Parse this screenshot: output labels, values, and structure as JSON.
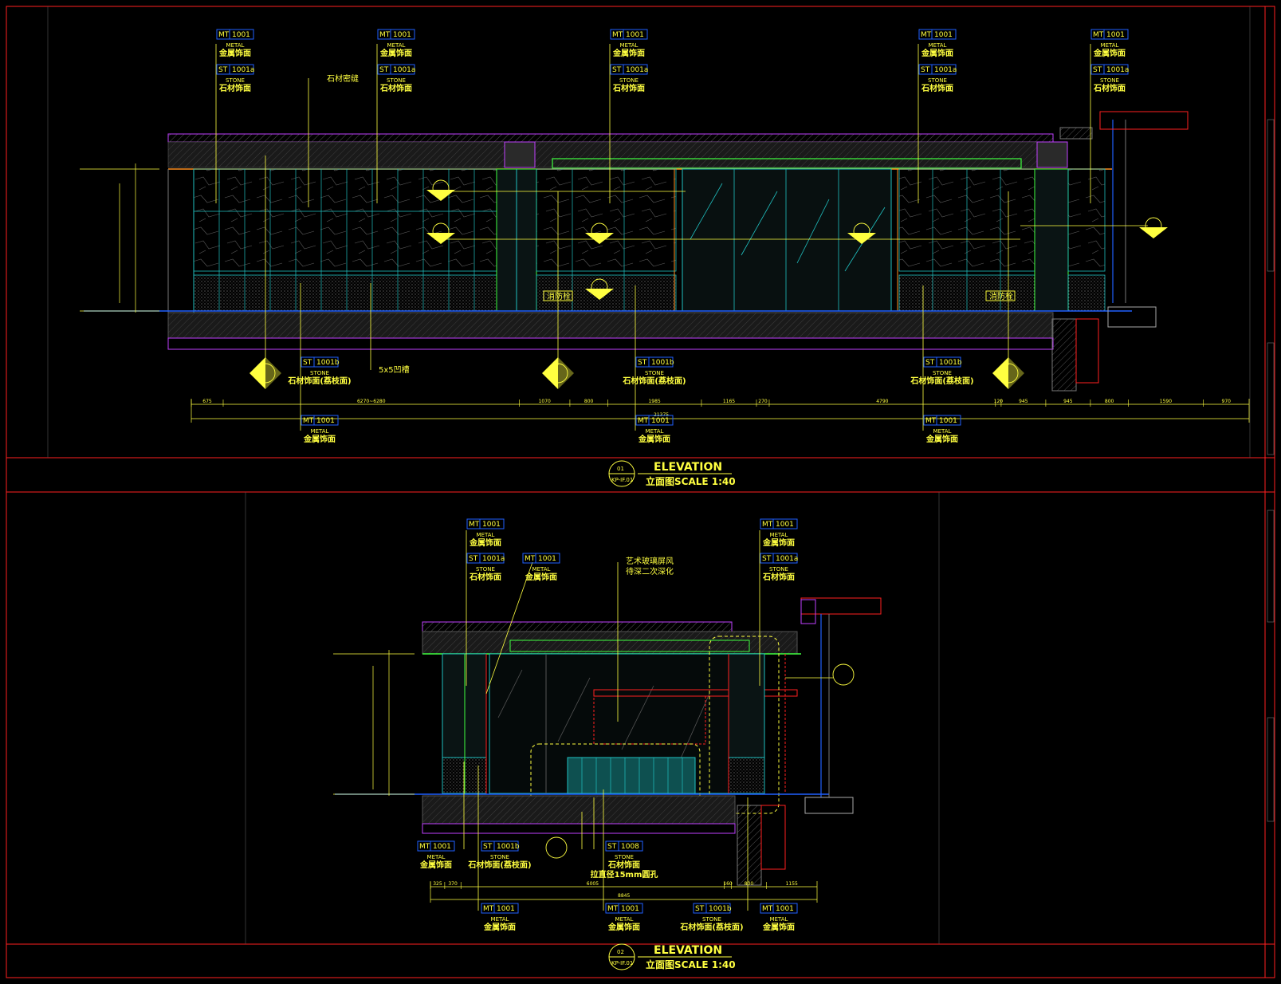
{
  "tags": {
    "mt": {
      "code_a": "MT",
      "code_b": "1001",
      "en": "METAL",
      "cn": "金属饰面"
    },
    "st_a": {
      "code_a": "ST",
      "code_b": "1001a",
      "en": "STONE",
      "cn": "石材饰面"
    },
    "st_b": {
      "code_a": "ST",
      "code_b": "1001b",
      "en": "STONE",
      "cn": "石材饰面(荔枝面)"
    },
    "st_c": {
      "code_a": "ST",
      "code_b": "1008",
      "en": "STONE",
      "cn": "石材饰面",
      "cn2": "拉直径15mm圆孔"
    }
  },
  "labels": {
    "stone_seal": "石材密缝",
    "groove_5x5": "5x5凹槽",
    "art_glass_1": "艺术玻璃屏风",
    "art_glass_2": "待深二次深化",
    "fire_hydrant": "消防栓"
  },
  "elevation1": {
    "bubble_num": "01",
    "bubble_ref": "KP-IF.01",
    "title_en": "ELEVATION",
    "title_cn": "立面图SCALE  1:40",
    "dims": [
      "675",
      "6270~6280",
      "1070",
      "800",
      "1985",
      "1165",
      "270",
      "4790",
      "120",
      "945",
      "945",
      "800",
      "1590",
      "970"
    ],
    "total": "21375"
  },
  "elevation2": {
    "bubble_num": "02",
    "bubble_ref": "KP-IF.01",
    "title_en": "ELEVATION",
    "title_cn": "立面图SCALE  1:40",
    "dims": [
      "325",
      "370",
      "6005",
      "160",
      "800",
      "1155"
    ],
    "total": "8845"
  },
  "colors": {
    "frame": "#ff2020",
    "yellow": "#ffff40",
    "magenta": "#c040ff",
    "green": "#40ff40",
    "cyan": "#20c0c0",
    "blue": "#2060ff",
    "orange": "#ff9020",
    "grey": "#707070"
  }
}
